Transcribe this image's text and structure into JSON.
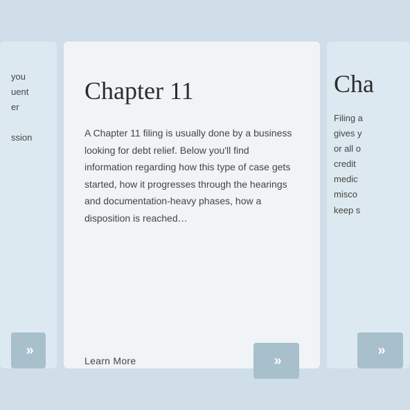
{
  "background_color": "#cfdee8",
  "cards": {
    "left_partial": {
      "text_lines": [
        "you",
        "uent",
        "er",
        "",
        "ssion"
      ],
      "chevron_label": "»"
    },
    "center": {
      "title": "Chapter 11",
      "body": "A Chapter 11 filing is usually done by a business looking for debt relief. Below you'll find information regarding how this type of case gets started, how it progresses through the hearings and documentation-heavy phases, how a disposition is reached…",
      "learn_more_label": "Learn More",
      "chevron_label": "»"
    },
    "right_partial": {
      "title": "Cha",
      "text_lines": [
        "Filing a",
        "gives y",
        "or all o",
        "credit",
        "medic",
        "misco",
        "keep s"
      ],
      "chevron_label": "»"
    }
  }
}
